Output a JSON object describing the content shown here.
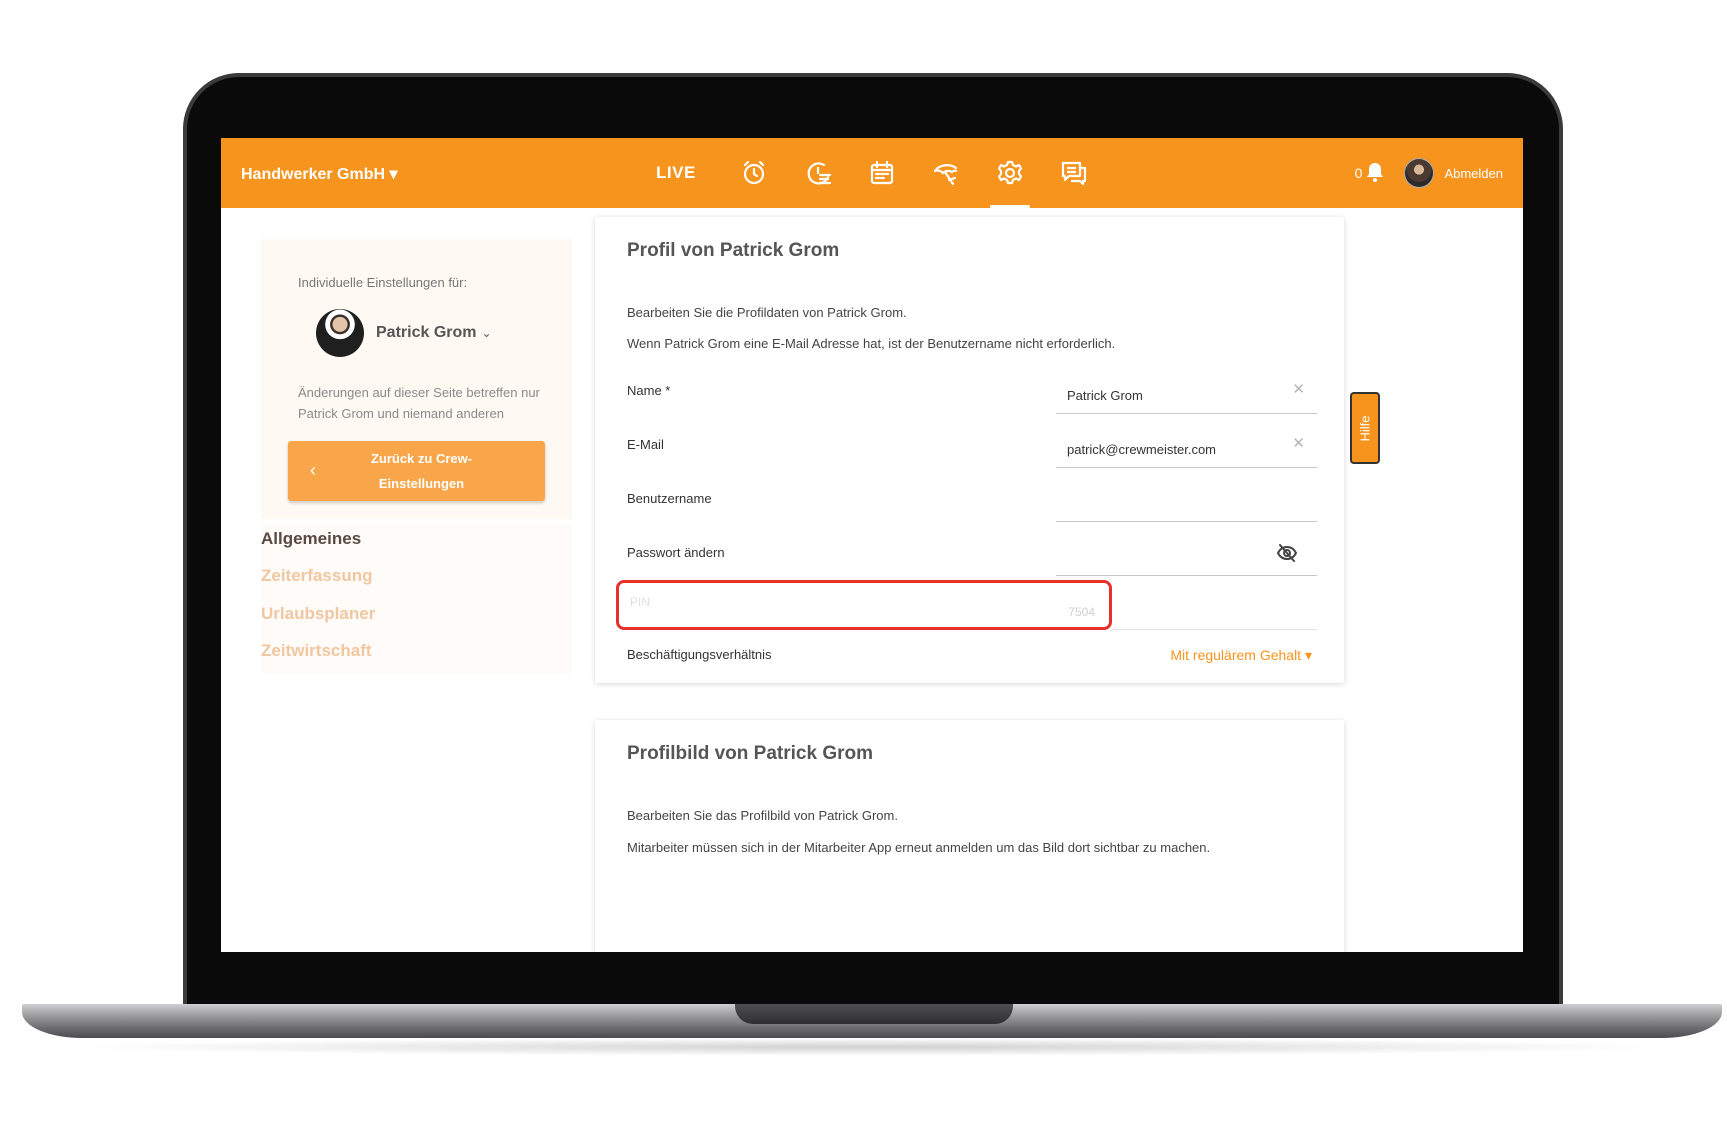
{
  "topbar": {
    "company": "Handwerker GmbH ▾",
    "live_label": "LIVE",
    "notification_count": "0",
    "logout_label": "Abmelden",
    "bg_color": "#f7941d"
  },
  "sidebar": {
    "individual_label": "Individuelle Einstellungen für:",
    "user_name": "Patrick Grom",
    "change_note": "Änderungen auf dieser Seite betreffen nur Patrick Grom und niemand anderen",
    "back_button_label": "Zurück zu Crew-Einstellungen",
    "menu": [
      {
        "label": "Allgemeines",
        "active": true
      },
      {
        "label": "Zeiterfassung",
        "active": false
      },
      {
        "label": "Urlaubsplaner",
        "active": false
      },
      {
        "label": "Zeitwirtschaft",
        "active": false
      }
    ]
  },
  "profile": {
    "title": "Profil von Patrick Grom",
    "desc1": "Bearbeiten Sie die Profildaten von Patrick Grom.",
    "desc2": "Wenn Patrick Grom eine E-Mail Adresse hat, ist der Benutzername nicht erforderlich.",
    "fields": {
      "name_label": "Name *",
      "name_value": "Patrick Grom",
      "email_label": "E-Mail",
      "email_value": "patrick@crewmeister.com",
      "username_label": "Benutzername",
      "username_value": "",
      "password_label": "Passwort ändern",
      "pin_label": "PIN",
      "pin_value": "7504",
      "employment_label": "Beschäftigungsverhältnis",
      "employment_value": "Mit regulärem Gehalt ▾"
    }
  },
  "profile_picture": {
    "title": "Profilbild von Patrick Grom",
    "desc1": "Bearbeiten Sie das Profilbild von Patrick Grom.",
    "desc2": "Mitarbeiter müssen sich in der Mitarbeiter App erneut anmelden um das Bild dort sichtbar zu machen."
  },
  "help_tab": "Hilfe",
  "icons": [
    "alarm-clock-icon",
    "timeline-icon",
    "calendar-icon",
    "beach-umbrella-icon",
    "gear-icon",
    "chat-icon",
    "bell-icon",
    "eye-off-icon",
    "close-icon"
  ]
}
